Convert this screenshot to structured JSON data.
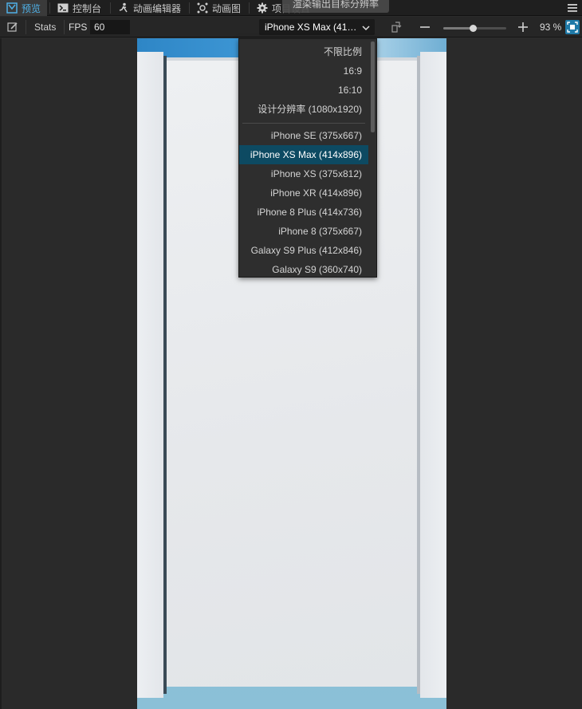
{
  "tabs": [
    {
      "label": "预览",
      "icon": "preview-icon"
    },
    {
      "label": "控制台",
      "icon": "console-icon"
    },
    {
      "label": "动画编辑器",
      "icon": "animation-editor-icon"
    },
    {
      "label": "动画图",
      "icon": "animation-graph-icon"
    },
    {
      "label": "项目设置",
      "icon": "gear-icon"
    }
  ],
  "tooltip": "渲染输出目标分辨率",
  "toolbar": {
    "stats_label": "Stats",
    "fps_label": "FPS",
    "fps_value": "60",
    "device_selected": "iPhone XS Max (41…",
    "zoom": {
      "value": 93,
      "min": 0,
      "max": 200,
      "display": "93 %"
    }
  },
  "dropdown": {
    "items": [
      "不限比例",
      "16:9",
      "16:10",
      "设计分辨率 (1080x1920)",
      "iPhone SE (375x667)",
      "iPhone XS Max (414x896)",
      "iPhone XS (375x812)",
      "iPhone XR (414x896)",
      "iPhone 8 Plus (414x736)",
      "iPhone 8 (375x667)",
      "Galaxy S9 Plus (412x846)",
      "Galaxy S9 (360x740)"
    ],
    "selected_index": 5
  },
  "colors": {
    "accent": "#4fb0e6",
    "selected_bg": "#0d4a62",
    "device_bg": "#8bc0d7"
  }
}
